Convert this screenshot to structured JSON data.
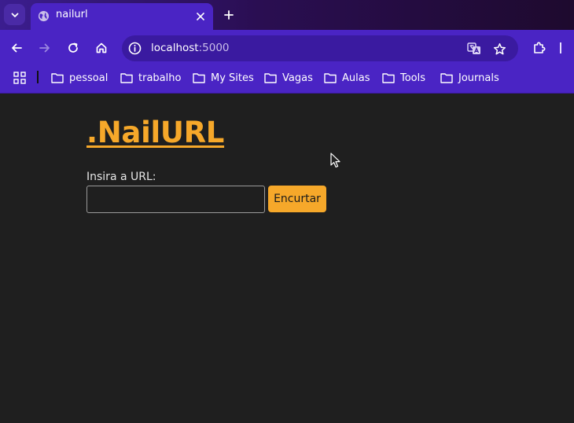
{
  "browser": {
    "tab": {
      "title": "nailurl",
      "favicon": "globe-icon"
    },
    "address": {
      "host": "localhost",
      "port": ":5000"
    },
    "bookmarks": [
      {
        "label": "pessoal"
      },
      {
        "label": "trabalho"
      },
      {
        "label": "My Sites"
      },
      {
        "label": "Vagas"
      },
      {
        "label": "Aulas"
      },
      {
        "label": "Tools"
      },
      {
        "label": "Journals"
      }
    ]
  },
  "page": {
    "logo": ".NailURL",
    "form": {
      "label": "Insira a URL:",
      "input_value": "",
      "submit_label": "Encurtar"
    }
  },
  "colors": {
    "accent": "#f6a82a",
    "chrome": "#4a24c4",
    "background": "#1f1f1f"
  }
}
